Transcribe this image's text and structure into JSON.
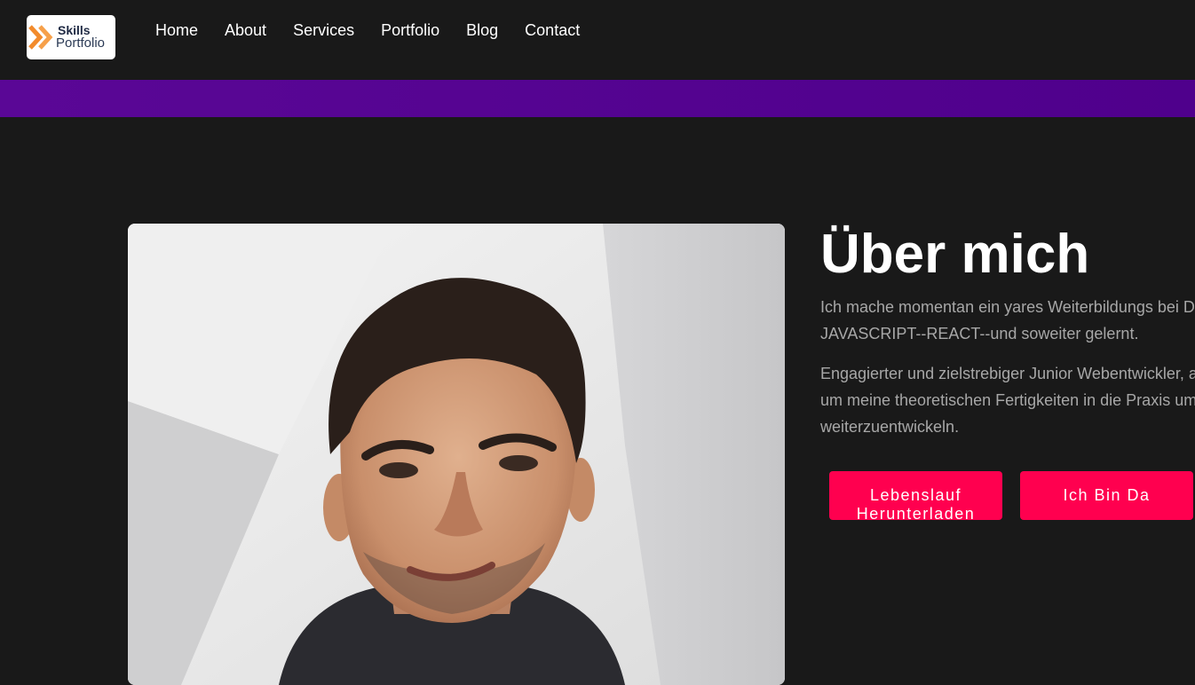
{
  "logo": {
    "line1": "Skills",
    "line2": "Portfolio"
  },
  "nav": {
    "items": [
      "Home",
      "About",
      "Services",
      "Portfolio",
      "Blog",
      "Contact"
    ]
  },
  "about": {
    "title": "Über mich",
    "paragraph1": [
      "Ich mache momentan ein yares Weiterbildungs bei D",
      "JAVASCRIPT--REACT--und soweiter gelernt."
    ],
    "paragraph2": [
      "Engagierter und zielstrebiger Junior Webentwickler, a",
      "um meine theoretischen Fertigkeiten in die Praxis um",
      "weiterzuentwickeln."
    ],
    "buttons": {
      "download_label_line1": "Lebenslauf",
      "download_label_line2": "Herunterladen",
      "here_label": "Ich Bin Da"
    }
  },
  "colors": {
    "background": "#191919",
    "accent_purple": "#4f008c",
    "button_red": "#ff004f",
    "text_muted": "#a7a7a7"
  },
  "icons": {
    "logo_mark": "double-chevron-icon"
  }
}
